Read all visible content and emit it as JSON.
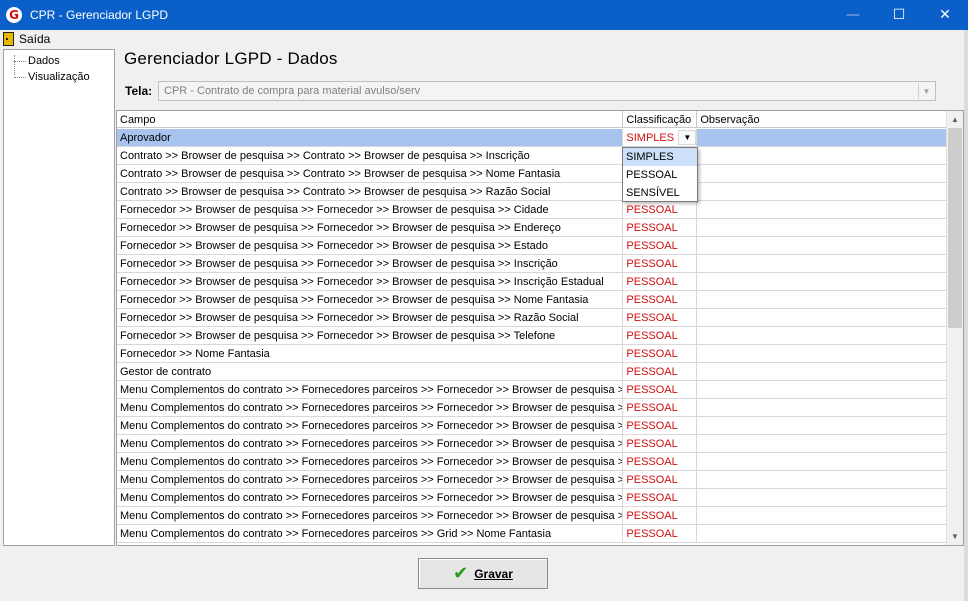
{
  "window": {
    "title": "CPR - Gerenciador LGPD",
    "icon": "app-logo-icon",
    "controls": {
      "minimize": "—",
      "maximize": "☐",
      "close": "✕"
    }
  },
  "menu": {
    "exit_label": "Saída"
  },
  "tree": {
    "items": [
      {
        "label": "Dados"
      },
      {
        "label": "Visualização"
      }
    ]
  },
  "page": {
    "title": "Gerenciador LGPD - Dados"
  },
  "tela": {
    "label": "Tela:",
    "value": "CPR - Contrato de compra para material avulso/serv"
  },
  "grid": {
    "headers": {
      "campo": "Campo",
      "classificacao": "Classificação",
      "observacao": "Observação"
    },
    "rows": [
      {
        "campo": "Aprovador",
        "classificacao": "SIMPLES",
        "observacao": ""
      },
      {
        "campo": "Contrato >> Browser de pesquisa >> Contrato >> Browser de pesquisa >> Inscrição",
        "classificacao": "",
        "observacao": ""
      },
      {
        "campo": "Contrato >> Browser de pesquisa >> Contrato >> Browser de pesquisa >> Nome Fantasia",
        "classificacao": "",
        "observacao": ""
      },
      {
        "campo": "Contrato >> Browser de pesquisa >> Contrato >> Browser de pesquisa >> Razão Social",
        "classificacao": "",
        "observacao": ""
      },
      {
        "campo": "Fornecedor >> Browser de pesquisa >> Fornecedor >> Browser de pesquisa >> Cidade",
        "classificacao": "PESSOAL",
        "observacao": ""
      },
      {
        "campo": "Fornecedor >> Browser de pesquisa >> Fornecedor >> Browser de pesquisa >> Endereço",
        "classificacao": "PESSOAL",
        "observacao": ""
      },
      {
        "campo": "Fornecedor >> Browser de pesquisa >> Fornecedor >> Browser de pesquisa >> Estado",
        "classificacao": "PESSOAL",
        "observacao": ""
      },
      {
        "campo": "Fornecedor >> Browser de pesquisa >> Fornecedor >> Browser de pesquisa >> Inscrição",
        "classificacao": "PESSOAL",
        "observacao": ""
      },
      {
        "campo": "Fornecedor >> Browser de pesquisa >> Fornecedor >> Browser de pesquisa >> Inscrição Estadual",
        "classificacao": "PESSOAL",
        "observacao": ""
      },
      {
        "campo": "Fornecedor >> Browser de pesquisa >> Fornecedor >> Browser de pesquisa >> Nome Fantasia",
        "classificacao": "PESSOAL",
        "observacao": ""
      },
      {
        "campo": "Fornecedor >> Browser de pesquisa >> Fornecedor >> Browser de pesquisa >> Razão Social",
        "classificacao": "PESSOAL",
        "observacao": ""
      },
      {
        "campo": "Fornecedor >> Browser de pesquisa >> Fornecedor >> Browser de pesquisa >> Telefone",
        "classificacao": "PESSOAL",
        "observacao": ""
      },
      {
        "campo": "Fornecedor >> Nome Fantasia",
        "classificacao": "PESSOAL",
        "observacao": ""
      },
      {
        "campo": "Gestor de contrato",
        "classificacao": "PESSOAL",
        "observacao": ""
      },
      {
        "campo": "Menu Complementos do contrato >> Fornecedores parceiros >> Fornecedor >> Browser de pesquisa >> ...",
        "classificacao": "PESSOAL",
        "observacao": ""
      },
      {
        "campo": "Menu Complementos do contrato >> Fornecedores parceiros >> Fornecedor >> Browser de pesquisa >> ...",
        "classificacao": "PESSOAL",
        "observacao": ""
      },
      {
        "campo": "Menu Complementos do contrato >> Fornecedores parceiros >> Fornecedor >> Browser de pesquisa >> ...",
        "classificacao": "PESSOAL",
        "observacao": ""
      },
      {
        "campo": "Menu Complementos do contrato >> Fornecedores parceiros >> Fornecedor >> Browser de pesquisa >> ...",
        "classificacao": "PESSOAL",
        "observacao": ""
      },
      {
        "campo": "Menu Complementos do contrato >> Fornecedores parceiros >> Fornecedor >> Browser de pesquisa >> ...",
        "classificacao": "PESSOAL",
        "observacao": ""
      },
      {
        "campo": "Menu Complementos do contrato >> Fornecedores parceiros >> Fornecedor >> Browser de pesquisa >> ...",
        "classificacao": "PESSOAL",
        "observacao": ""
      },
      {
        "campo": "Menu Complementos do contrato >> Fornecedores parceiros >> Fornecedor >> Browser de pesquisa >> ...",
        "classificacao": "PESSOAL",
        "observacao": ""
      },
      {
        "campo": "Menu Complementos do contrato >> Fornecedores parceiros >> Fornecedor >> Browser de pesquisa >> ...",
        "classificacao": "PESSOAL",
        "observacao": ""
      },
      {
        "campo": "Menu Complementos do contrato >> Fornecedores parceiros >> Grid >> Nome Fantasia",
        "classificacao": "PESSOAL",
        "observacao": ""
      }
    ]
  },
  "dropdown": {
    "options": [
      "SIMPLES",
      "PESSOAL",
      "SENSÍVEL"
    ],
    "active_index": 0
  },
  "footer": {
    "save_label": "Gravar"
  },
  "colors": {
    "titlebar": "#0a60c8",
    "selected_row": "#a8c4ee",
    "classification_text": "#d01010",
    "check_icon": "#2a9a20"
  }
}
